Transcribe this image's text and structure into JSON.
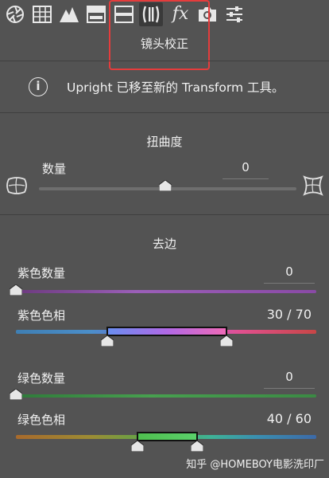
{
  "toolbar": {
    "tools": [
      {
        "icon": "aperture-icon"
      },
      {
        "icon": "grid-icon"
      },
      {
        "icon": "mountain-icon"
      },
      {
        "icon": "split-tone-icon"
      },
      {
        "icon": "detail-icon"
      },
      {
        "icon": "lens-correction-icon",
        "active": true
      },
      {
        "icon": "fx-icon",
        "label": "fx"
      },
      {
        "icon": "camera-icon"
      },
      {
        "icon": "presets-sliders-icon"
      }
    ]
  },
  "panel": {
    "title": "镜头校正"
  },
  "info": {
    "icon_glyph": "i",
    "message": "Upright 已移至新的 Transform 工具。"
  },
  "distortion": {
    "title": "扭曲度",
    "amount_label": "数量",
    "amount_value": "0",
    "slider_level": 0.5
  },
  "defringe": {
    "title": "去边",
    "purple_amount_label": "紫色数量",
    "purple_amount_value": "0",
    "purple_hue_label": "紫色色相",
    "purple_hue_value": "30 / 70",
    "purple_hue_range": [
      30,
      70
    ],
    "green_amount_label": "绿色数量",
    "green_amount_value": "0",
    "green_hue_label": "绿色色相",
    "green_hue_value": "40 / 60",
    "green_hue_range": [
      40,
      60
    ]
  },
  "watermark": "知乎 @HOMEBOY电影洗印厂",
  "colors": {
    "panel_bg": "#535353",
    "highlight": "#e53c3c"
  }
}
